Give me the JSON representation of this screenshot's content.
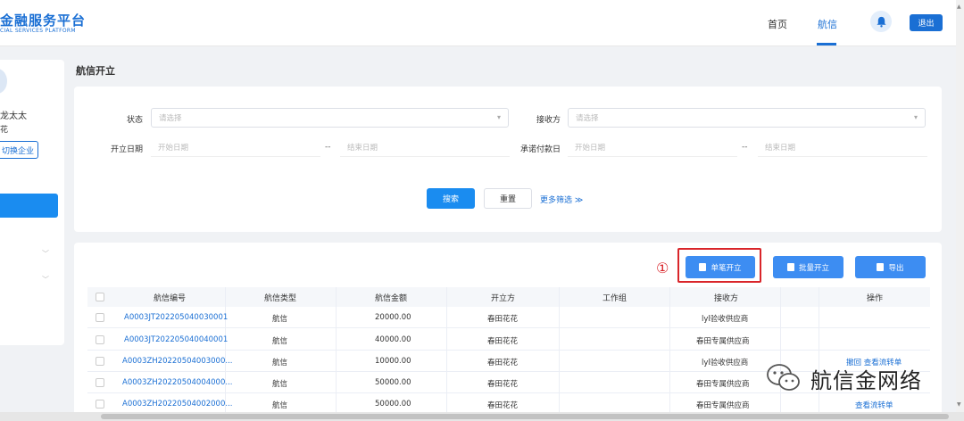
{
  "header": {
    "logo_cn": "金融服务平台",
    "logo_en": "CIAL SERVICES PLATFORM",
    "nav": [
      "首页",
      "航信"
    ],
    "logout_label": "退出"
  },
  "sidebar": {
    "user_name": "龙太太",
    "user_sub": "花",
    "switch_label": "切换企业"
  },
  "page_title": "航信开立",
  "filters": {
    "status_label": "状态",
    "status_placeholder": "请选择",
    "receiver_label": "接收方",
    "receiver_placeholder": "请选择",
    "open_date_label": "开立日期",
    "promise_date_label": "承诺付款日",
    "start_placeholder": "开始日期",
    "end_placeholder": "结束日期",
    "separator": "--",
    "search_label": "搜索",
    "reset_label": "重置",
    "more_label": "更多筛选 ≫"
  },
  "actions": {
    "annotation": "①",
    "single_label": "单笔开立",
    "batch_label": "批量开立",
    "export_label": "导出"
  },
  "table": {
    "columns": [
      "航信编号",
      "航信类型",
      "航信金额",
      "开立方",
      "工作组",
      "接收方",
      "操作"
    ],
    "rows": [
      {
        "id": "A0003JT202205040030001",
        "type": "航信",
        "amount": "20000.00",
        "issuer": "春田花花",
        "group": "",
        "receiver": "lyl验收供应商",
        "ops": ""
      },
      {
        "id": "A0003JT202205040040001",
        "type": "航信",
        "amount": "40000.00",
        "issuer": "春田花花",
        "group": "",
        "receiver": "春田专属供应商",
        "ops": ""
      },
      {
        "id": "A0003ZH20220504003000...",
        "type": "航信",
        "amount": "10000.00",
        "issuer": "春田花花",
        "group": "",
        "receiver": "lyl验收供应商",
        "ops": "撤回  查看流转单"
      },
      {
        "id": "A0003ZH20220504004000...",
        "type": "航信",
        "amount": "50000.00",
        "issuer": "春田花花",
        "group": "",
        "receiver": "春田专属供应商",
        "ops": ""
      },
      {
        "id": "A0003ZH20220504002000...",
        "type": "航信",
        "amount": "50000.00",
        "issuer": "春田花花",
        "group": "",
        "receiver": "春田专属供应商",
        "ops": "查看流转单"
      }
    ]
  },
  "watermark": "航信金网络",
  "colors": {
    "primary": "#1a6fd4",
    "accent": "#1a8cf0",
    "annotation": "#d9252a"
  }
}
